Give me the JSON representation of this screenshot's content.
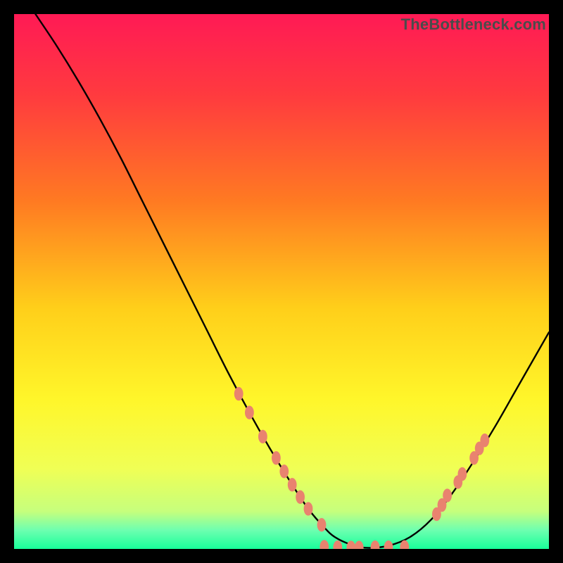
{
  "watermark": "TheBottleneck.com",
  "chart_data": {
    "type": "line",
    "title": "",
    "xlabel": "",
    "ylabel": "",
    "xlim": [
      0,
      100
    ],
    "ylim": [
      0,
      100
    ],
    "grid": false,
    "legend": false,
    "background_gradient": [
      {
        "offset": 0.0,
        "color": "#ff1a55"
      },
      {
        "offset": 0.15,
        "color": "#ff3a3f"
      },
      {
        "offset": 0.35,
        "color": "#ff7a22"
      },
      {
        "offset": 0.55,
        "color": "#ffcf1a"
      },
      {
        "offset": 0.72,
        "color": "#fff62a"
      },
      {
        "offset": 0.85,
        "color": "#f0ff55"
      },
      {
        "offset": 0.93,
        "color": "#c6ff7d"
      },
      {
        "offset": 0.965,
        "color": "#6dffb0"
      },
      {
        "offset": 1.0,
        "color": "#18ff9a"
      }
    ],
    "series": [
      {
        "name": "bottleneck-curve",
        "color": "#000000",
        "x": [
          4,
          8,
          12,
          16,
          20,
          24,
          28,
          32,
          36,
          40,
          44,
          48,
          52,
          55,
          58,
          60,
          63,
          66,
          70,
          74,
          78,
          82,
          86,
          90,
          94,
          98,
          100
        ],
        "y": [
          100,
          94,
          87.5,
          80.5,
          73,
          65,
          57,
          49,
          41,
          33,
          25.5,
          18.5,
          12,
          7.5,
          4,
          2.2,
          0.8,
          0.2,
          0.6,
          2.2,
          5.5,
          10.5,
          16.5,
          23,
          30,
          37,
          40.5
        ]
      }
    ],
    "markers": {
      "name": "highlight-dots",
      "color": "#e9836f",
      "radius": 8.2,
      "points": [
        {
          "x": 42,
          "y": 29
        },
        {
          "x": 44,
          "y": 25.5
        },
        {
          "x": 46.5,
          "y": 21
        },
        {
          "x": 49,
          "y": 17
        },
        {
          "x": 50.5,
          "y": 14.5
        },
        {
          "x": 52,
          "y": 12
        },
        {
          "x": 53.5,
          "y": 9.7
        },
        {
          "x": 55,
          "y": 7.5
        },
        {
          "x": 57.5,
          "y": 4.5
        },
        {
          "x": 58,
          "y": 0.4
        },
        {
          "x": 60.5,
          "y": 0.3
        },
        {
          "x": 63,
          "y": 0.25
        },
        {
          "x": 64.5,
          "y": 0.25
        },
        {
          "x": 67.5,
          "y": 0.3
        },
        {
          "x": 70,
          "y": 0.3
        },
        {
          "x": 73,
          "y": 0.35
        },
        {
          "x": 79,
          "y": 6.5
        },
        {
          "x": 80,
          "y": 8.2
        },
        {
          "x": 81,
          "y": 10
        },
        {
          "x": 83,
          "y": 12.5
        },
        {
          "x": 83.8,
          "y": 14
        },
        {
          "x": 86,
          "y": 17
        },
        {
          "x": 87,
          "y": 18.8
        },
        {
          "x": 88,
          "y": 20.3
        }
      ]
    }
  }
}
